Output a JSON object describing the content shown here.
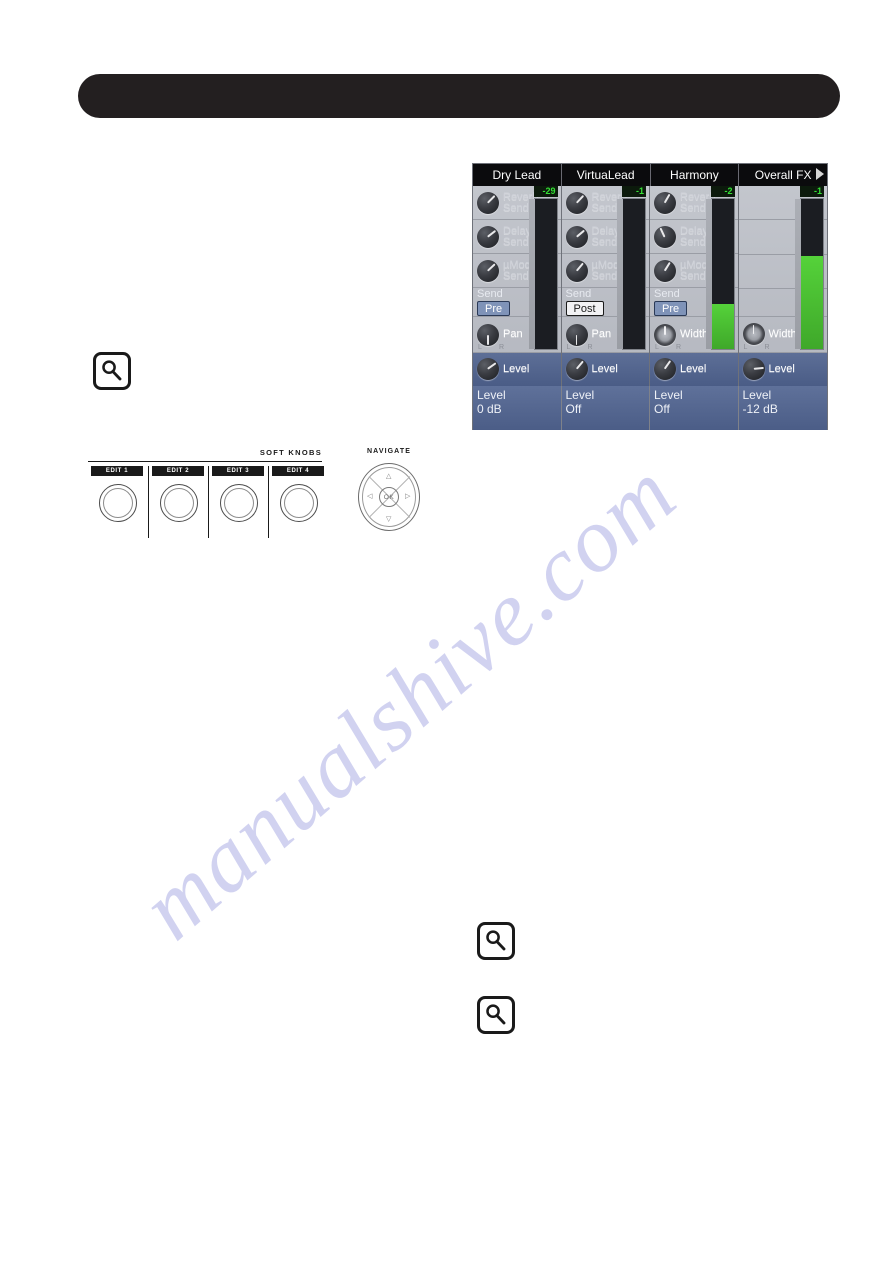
{
  "watermark": {
    "text": "manualshive.com"
  },
  "header": {
    "title": ""
  },
  "icons": {
    "magnifier_name": "magnifier-icon",
    "magnifier_top": "magnifier-icon-1",
    "magnifier_mid": "magnifier-icon-2",
    "magnifier_low": "magnifier-icon-3"
  },
  "soft_knobs": {
    "section_title": "SOFT KNOBS",
    "knobs": [
      {
        "label": "EDIT 1"
      },
      {
        "label": "EDIT 2"
      },
      {
        "label": "EDIT 3"
      },
      {
        "label": "EDIT 4"
      }
    ]
  },
  "navigate": {
    "title": "NAVIGATE",
    "ok_label": "OK",
    "up": "△",
    "down": "▽",
    "left": "◁",
    "right": "▷"
  },
  "mixer": {
    "tabs": [
      {
        "label": "Dry Lead",
        "has_arrow": false
      },
      {
        "label": "VirtuaLead",
        "has_arrow": false
      },
      {
        "label": "Harmony",
        "has_arrow": false
      },
      {
        "label": "Overall FX",
        "has_arrow": true
      }
    ],
    "row_labels": {
      "reverb_l1": "Reverb",
      "reverb_l2": "Send",
      "delay_l1": "Delay",
      "delay_l2": "Send",
      "umod_l1": "µMod",
      "umod_l2": "Send",
      "send": "Send",
      "pan": "Pan",
      "width": "Width",
      "level": "Level",
      "pan_left": "L",
      "pan_right": "R"
    },
    "channels": [
      {
        "name": "Dry Lead",
        "reverb_send": true,
        "delay_send": true,
        "umod_send": true,
        "send_mode": "Pre",
        "send_mode_active": false,
        "width_knob": false,
        "pan_label": "Pan",
        "meter_value": "-29",
        "meter_fill_percent": 0,
        "footer_label": "Level",
        "footer_value": "0 dB"
      },
      {
        "name": "VirtuaLead",
        "reverb_send": true,
        "delay_send": true,
        "umod_send": true,
        "send_mode": "Post",
        "send_mode_active": true,
        "width_knob": false,
        "pan_label": "Pan",
        "meter_value": "-1",
        "meter_fill_percent": 0,
        "footer_label": "Level",
        "footer_value": "Off"
      },
      {
        "name": "Harmony",
        "reverb_send": true,
        "delay_send": true,
        "umod_send": true,
        "send_mode": "Pre",
        "send_mode_active": false,
        "width_knob": true,
        "pan_label": "Width",
        "meter_value": "-2",
        "meter_fill_percent": 30,
        "footer_label": "Level",
        "footer_value": "Off"
      },
      {
        "name": "Overall FX",
        "reverb_send": false,
        "delay_send": false,
        "umod_send": false,
        "send_mode": "",
        "send_mode_active": false,
        "width_knob": true,
        "pan_label": "Width",
        "meter_value": "-1",
        "meter_fill_percent": 62,
        "footer_label": "Level",
        "footer_value": "-12 dB"
      }
    ]
  },
  "colors": {
    "screen_bg": "#b8bbc3",
    "tab_bar": "#0b0b0d",
    "footer_blue": "#4b5d87",
    "meter_green": "#3fa82a",
    "meter_text_green": "#35e035",
    "watermark": "#c9cbee",
    "header_bar": "#231f20"
  }
}
